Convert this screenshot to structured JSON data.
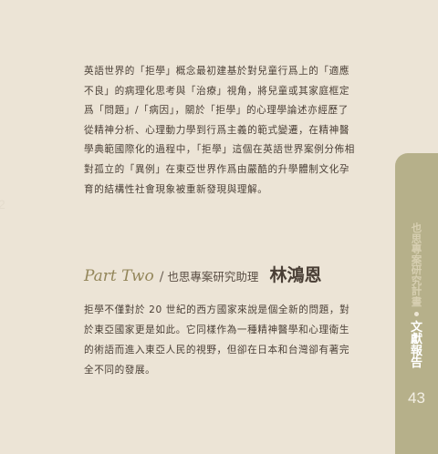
{
  "body": {
    "paragraph_1": "英語世界的「拒學」概念最初建基於對兒童行爲上的「適應不良」的病理化思考與「治療」視角，將兒童或其家庭框定爲「問題」/「病因」，關於「拒學」的心理學論述亦經歷了從精神分析、心理動力學到行爲主義的範式變遷，在精神醫學典範國際化的過程中，「拒學」這個在英語世界案例分佈相對孤立的「異例」在東亞世界作爲由嚴酷的升學體制文化孕育的結構性社會現象被重新發現與理解。",
    "paragraph_2": "拒學不僅對於 20 世紀的西方國家來說是個全新的問題，對於東亞國家更是如此。它同樣作為一種精神醫學和心理衛生的術語而進入東亞人民的視野，但卻在日本和台灣卻有著完全不同的發展。"
  },
  "section": {
    "part_title": "Part Two",
    "slash": "/",
    "role": "也思專案研究助理",
    "author": "林鴻恩"
  },
  "margin": {
    "faint_number": "2"
  },
  "side_tab": {
    "project_chars": [
      "也",
      "思",
      "專",
      "案",
      "研",
      "究",
      "計",
      "畫"
    ],
    "report_chars": [
      "文",
      "獻",
      "報",
      "告"
    ],
    "page_number": "43"
  },
  "colors": {
    "background": "#ece4d6",
    "text": "#4a3f36",
    "accent_olive": "#93865a",
    "tab": "#b6b08a"
  }
}
